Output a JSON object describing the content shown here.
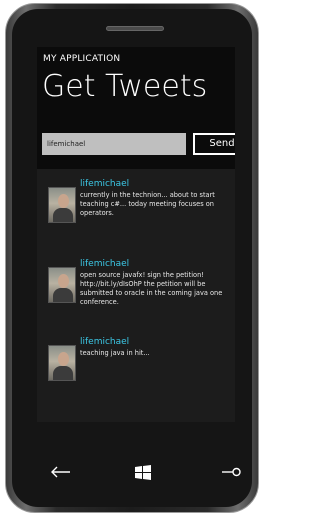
{
  "app": {
    "title": "MY APPLICATION",
    "page_title": "Get Tweets"
  },
  "search": {
    "value": "lifemichael",
    "send_label": "Send"
  },
  "tweets": [
    {
      "user": "lifemichael",
      "text": "currently in the technion... about to start teaching c#... today meeting focuses on operators."
    },
    {
      "user": "lifemichael",
      "text": "open source javafx! sign the petition! http://bit.ly/dIsOhP the petition will be submitted to oracle in the coming java one conference."
    },
    {
      "user": "lifemichael",
      "text": "teaching java in hit..."
    }
  ],
  "hardware_buttons": {
    "back_icon": "back-arrow-icon",
    "start_icon": "windows-logo-icon",
    "search_icon": "search-icon"
  },
  "colors": {
    "accent": "#3cc8e6",
    "background": "#0b0b0b",
    "list_background": "#1c1c1c"
  }
}
